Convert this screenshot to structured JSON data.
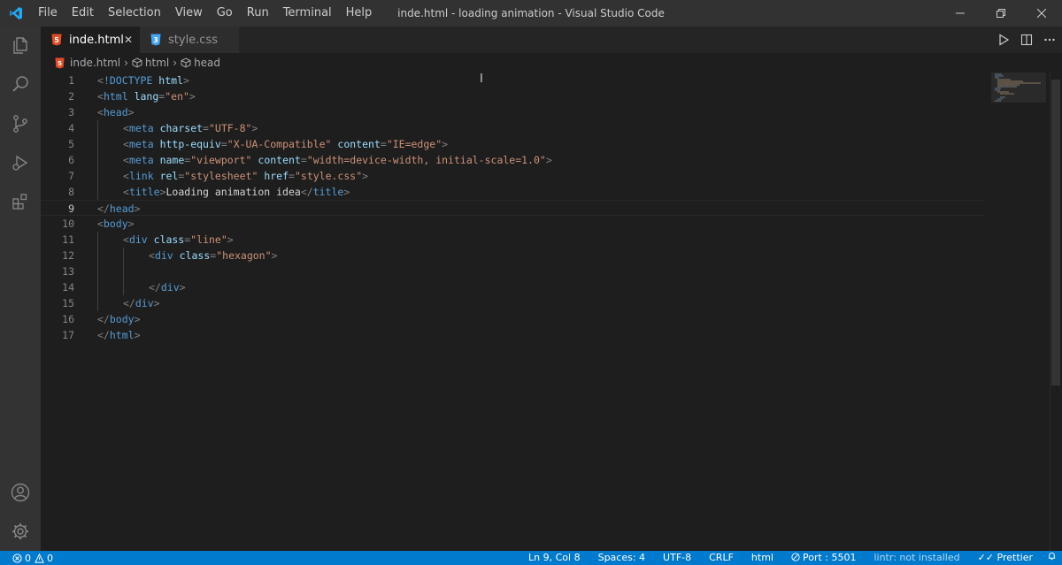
{
  "window": {
    "title": "inde.html - loading animation - Visual Studio Code"
  },
  "menu": [
    "File",
    "Edit",
    "Selection",
    "View",
    "Go",
    "Run",
    "Terminal",
    "Help"
  ],
  "tabs": [
    {
      "label": "inde.html",
      "icon": "html5-icon",
      "active": true,
      "close": "✕"
    },
    {
      "label": "style.css",
      "icon": "css3-icon",
      "active": false
    }
  ],
  "breadcrumb": [
    "inde.html",
    "html",
    "head"
  ],
  "editor": {
    "current_line": 9,
    "lines": [
      {
        "n": "1",
        "indent": 0,
        "tokens": [
          [
            "p",
            "<"
          ],
          [
            "t",
            "!DOCTYPE"
          ],
          [
            "x",
            " "
          ],
          [
            "a",
            "html"
          ],
          [
            "p",
            ">"
          ]
        ]
      },
      {
        "n": "2",
        "indent": 0,
        "tokens": [
          [
            "p",
            "<"
          ],
          [
            "t",
            "html"
          ],
          [
            "x",
            " "
          ],
          [
            "a",
            "lang"
          ],
          [
            "p",
            "="
          ],
          [
            "s",
            "\"en\""
          ],
          [
            "p",
            ">"
          ]
        ]
      },
      {
        "n": "3",
        "indent": 0,
        "tokens": [
          [
            "p",
            "<"
          ],
          [
            "t",
            "head"
          ],
          [
            "p",
            ">"
          ]
        ]
      },
      {
        "n": "4",
        "indent": 1,
        "tokens": [
          [
            "p",
            "<"
          ],
          [
            "t",
            "meta"
          ],
          [
            "x",
            " "
          ],
          [
            "a",
            "charset"
          ],
          [
            "p",
            "="
          ],
          [
            "s",
            "\"UTF-8\""
          ],
          [
            "p",
            ">"
          ]
        ]
      },
      {
        "n": "5",
        "indent": 1,
        "tokens": [
          [
            "p",
            "<"
          ],
          [
            "t",
            "meta"
          ],
          [
            "x",
            " "
          ],
          [
            "a",
            "http-equiv"
          ],
          [
            "p",
            "="
          ],
          [
            "s",
            "\"X-UA-Compatible\""
          ],
          [
            "x",
            " "
          ],
          [
            "a",
            "content"
          ],
          [
            "p",
            "="
          ],
          [
            "s",
            "\"IE=edge\""
          ],
          [
            "p",
            ">"
          ]
        ]
      },
      {
        "n": "6",
        "indent": 1,
        "tokens": [
          [
            "p",
            "<"
          ],
          [
            "t",
            "meta"
          ],
          [
            "x",
            " "
          ],
          [
            "a",
            "name"
          ],
          [
            "p",
            "="
          ],
          [
            "s",
            "\"viewport\""
          ],
          [
            "x",
            " "
          ],
          [
            "a",
            "content"
          ],
          [
            "p",
            "="
          ],
          [
            "s",
            "\"width=device-width, initial-scale=1.0\""
          ],
          [
            "p",
            ">"
          ]
        ]
      },
      {
        "n": "7",
        "indent": 1,
        "tokens": [
          [
            "p",
            "<"
          ],
          [
            "t",
            "link"
          ],
          [
            "x",
            " "
          ],
          [
            "a",
            "rel"
          ],
          [
            "p",
            "="
          ],
          [
            "s",
            "\"stylesheet\""
          ],
          [
            "x",
            " "
          ],
          [
            "a",
            "href"
          ],
          [
            "p",
            "="
          ],
          [
            "s",
            "\"style.css\""
          ],
          [
            "p",
            ">"
          ]
        ]
      },
      {
        "n": "8",
        "indent": 1,
        "tokens": [
          [
            "p",
            "<"
          ],
          [
            "t",
            "title"
          ],
          [
            "p",
            ">"
          ],
          [
            "x",
            "Loading animation idea"
          ],
          [
            "p",
            "</"
          ],
          [
            "t",
            "title"
          ],
          [
            "p",
            ">"
          ]
        ]
      },
      {
        "n": "9",
        "indent": 0,
        "tokens": [
          [
            "p",
            "</"
          ],
          [
            "t",
            "head"
          ],
          [
            "p",
            ">"
          ]
        ]
      },
      {
        "n": "10",
        "indent": 0,
        "tokens": [
          [
            "p",
            "<"
          ],
          [
            "t",
            "body"
          ],
          [
            "p",
            ">"
          ]
        ]
      },
      {
        "n": "11",
        "indent": 1,
        "tokens": [
          [
            "p",
            "<"
          ],
          [
            "t",
            "div"
          ],
          [
            "x",
            " "
          ],
          [
            "a",
            "class"
          ],
          [
            "p",
            "="
          ],
          [
            "s",
            "\"line\""
          ],
          [
            "p",
            ">"
          ]
        ]
      },
      {
        "n": "12",
        "indent": 2,
        "tokens": [
          [
            "p",
            "<"
          ],
          [
            "t",
            "div"
          ],
          [
            "x",
            " "
          ],
          [
            "a",
            "class"
          ],
          [
            "p",
            "="
          ],
          [
            "s",
            "\"hexagon\""
          ],
          [
            "p",
            ">"
          ]
        ]
      },
      {
        "n": "13",
        "indent": 0,
        "tokens": []
      },
      {
        "n": "14",
        "indent": 2,
        "tokens": [
          [
            "p",
            "</"
          ],
          [
            "t",
            "div"
          ],
          [
            "p",
            ">"
          ]
        ]
      },
      {
        "n": "15",
        "indent": 1,
        "tokens": [
          [
            "p",
            "</"
          ],
          [
            "t",
            "div"
          ],
          [
            "p",
            ">"
          ]
        ]
      },
      {
        "n": "16",
        "indent": 0,
        "tokens": [
          [
            "p",
            "</"
          ],
          [
            "t",
            "body"
          ],
          [
            "p",
            ">"
          ]
        ]
      },
      {
        "n": "17",
        "indent": 0,
        "tokens": [
          [
            "p",
            "</"
          ],
          [
            "t",
            "html"
          ],
          [
            "p",
            ">"
          ]
        ]
      }
    ]
  },
  "status": {
    "problems_errors": "0",
    "problems_warnings": "0",
    "cursor_pos": "Ln 9, Col 8",
    "spaces": "Spaces: 4",
    "encoding": "UTF-8",
    "eol": "CRLF",
    "language": "html",
    "live_server": "Port : 5501",
    "extension": "lintr: not installed",
    "prettier": "Prettier"
  },
  "colors": {
    "accent": "#007acc",
    "html_icon": "#e44d26",
    "css_icon": "#42a5f5",
    "vscode_logo": "#23a9f2"
  }
}
